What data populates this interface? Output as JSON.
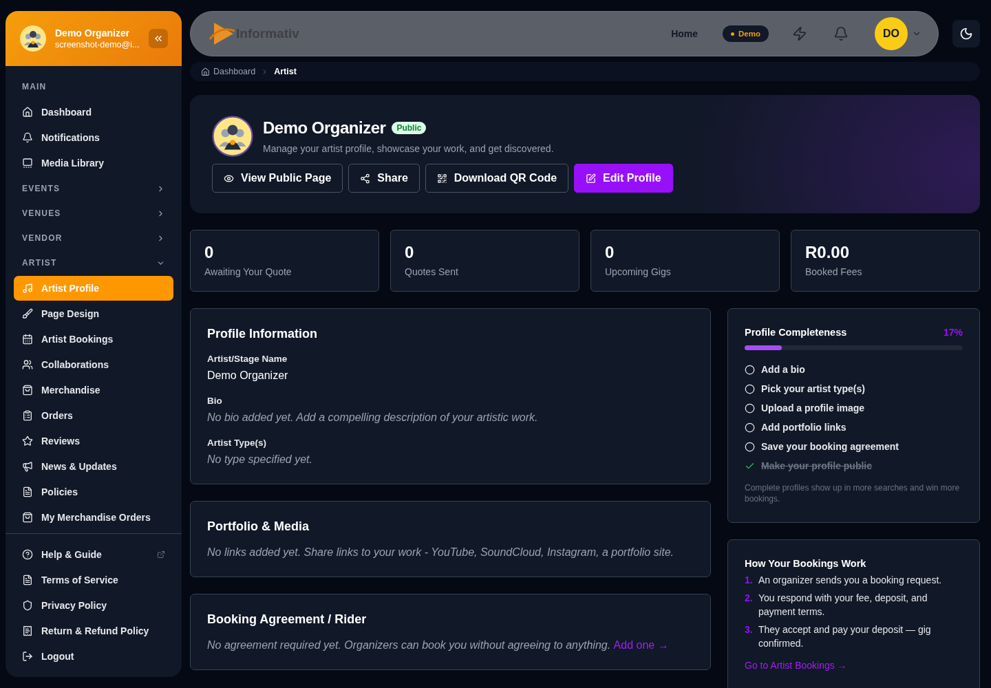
{
  "user": {
    "name": "Demo Organizer",
    "email": "screenshot-demo@i..."
  },
  "sidebar": {
    "items": [
      {
        "kind": "section",
        "label": "MAIN"
      },
      {
        "kind": "link",
        "label": "Dashboard",
        "selected": false
      },
      {
        "kind": "link",
        "label": "Notifications",
        "selected": false
      },
      {
        "kind": "link",
        "label": "Media Library",
        "selected": false
      },
      {
        "kind": "section",
        "label": "EVENTS",
        "expanded": false
      },
      {
        "kind": "section",
        "label": "VENUES",
        "expanded": false
      },
      {
        "kind": "section",
        "label": "VENDOR",
        "expanded": false
      },
      {
        "kind": "section",
        "label": "ARTIST",
        "expanded": true
      },
      {
        "kind": "link",
        "label": "Artist Profile",
        "selected": true
      },
      {
        "kind": "link",
        "label": "Page Design",
        "selected": false
      },
      {
        "kind": "link",
        "label": "Artist Bookings",
        "selected": false
      },
      {
        "kind": "link",
        "label": "Collaborations",
        "selected": false
      },
      {
        "kind": "link",
        "label": "Merchandise",
        "selected": false
      },
      {
        "kind": "link",
        "label": "Orders",
        "selected": false
      },
      {
        "kind": "link",
        "label": "Reviews",
        "selected": false
      },
      {
        "kind": "link",
        "label": "News & Updates",
        "selected": false
      },
      {
        "kind": "link",
        "label": "Policies",
        "selected": false
      },
      {
        "kind": "link",
        "label": "My Merchandise Orders",
        "selected": false
      }
    ],
    "footer_items": [
      {
        "label": "Help & Guide",
        "external": true
      },
      {
        "label": "Terms of Service",
        "external": false
      },
      {
        "label": "Privacy Policy",
        "external": false
      },
      {
        "label": "Return & Refund Policy",
        "external": false
      },
      {
        "label": "Logout",
        "external": false
      }
    ]
  },
  "topbar": {
    "logo": "Informativ",
    "home": "Home",
    "badge": "Demo",
    "avatar": "DO"
  },
  "breadcrumb": [
    {
      "label": "Dashboard",
      "current": false
    },
    {
      "label": "Artist",
      "current": true
    }
  ],
  "hero": {
    "name": "Demo Organizer",
    "status": "Public",
    "subtitle": "Manage your artist profile, showcase your work, and get discovered.",
    "buttons": [
      {
        "label": "View Public Page",
        "primary": false
      },
      {
        "label": "Share",
        "primary": false
      },
      {
        "label": "Download QR Code",
        "primary": false
      },
      {
        "label": "Edit Profile",
        "primary": true
      }
    ]
  },
  "stats": [
    {
      "value": "0",
      "label": "Awaiting Your Quote"
    },
    {
      "value": "0",
      "label": "Quotes Sent"
    },
    {
      "value": "0",
      "label": "Upcoming Gigs"
    },
    {
      "value": "R0.00",
      "label": "Booked Fees"
    }
  ],
  "profile_info": {
    "title": "Profile Information",
    "fields": [
      {
        "label": "Artist/Stage Name",
        "value": "Demo Organizer",
        "empty": false
      },
      {
        "label": "Bio",
        "value": "No bio added yet. Add a compelling description of your artistic work.",
        "empty": true
      },
      {
        "label": "Artist Type(s)",
        "value": "No type specified yet.",
        "empty": true
      }
    ]
  },
  "portfolio": {
    "title": "Portfolio & Media",
    "text": "No links added yet. Share links to your work - YouTube, SoundCloud, Instagram, a portfolio site."
  },
  "agreement": {
    "title": "Booking Agreement / Rider",
    "text": "No agreement required yet. Organizers can book you without agreeing to anything.",
    "link": "Add one →"
  },
  "completeness": {
    "title": "Profile Completeness",
    "percent": "17%",
    "level": 0.17,
    "items": [
      {
        "label": "Add a bio",
        "done": false
      },
      {
        "label": "Pick your artist type(s)",
        "done": false
      },
      {
        "label": "Upload a profile image",
        "done": false
      },
      {
        "label": "Add portfolio links",
        "done": false
      },
      {
        "label": "Save your booking agreement",
        "done": false
      },
      {
        "label": "Make your profile public",
        "done": true
      }
    ],
    "note": "Complete profiles show up in more searches and win more bookings."
  },
  "how": {
    "title": "How Your Bookings Work",
    "steps": [
      {
        "number": "1.",
        "text": "An organizer sends you a booking request."
      },
      {
        "number": "2.",
        "text": "You respond with your fee, deposit, and payment terms."
      },
      {
        "number": "3.",
        "text": "They accept and pay your deposit — gig confirmed."
      }
    ],
    "link": "Go to Artist Bookings →"
  }
}
